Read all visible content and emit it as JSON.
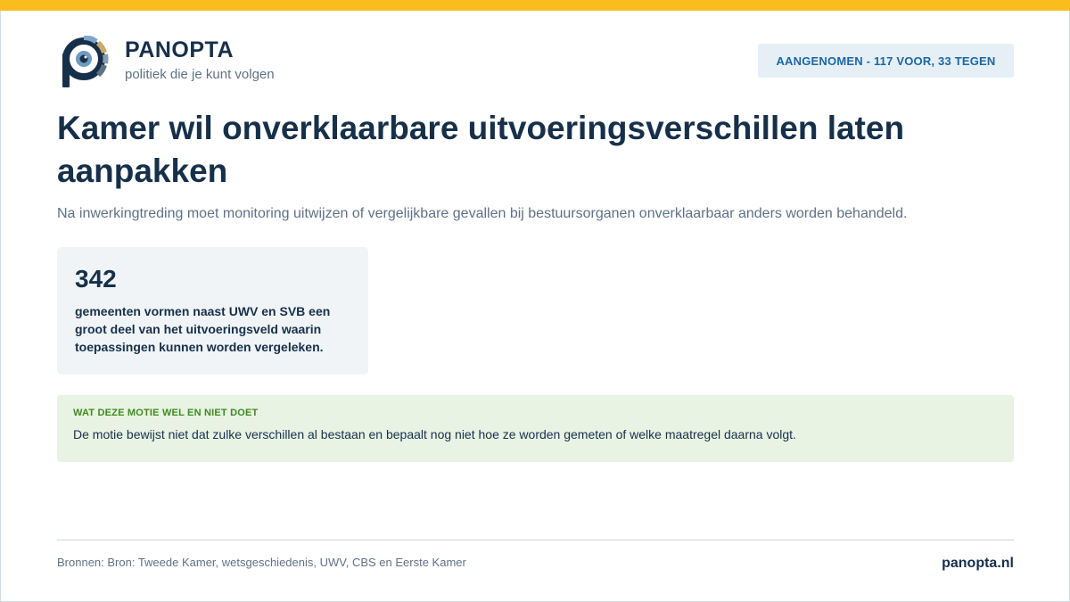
{
  "brand": {
    "name": "PANOPTA",
    "tagline": "politiek die je kunt volgen",
    "logo_icon": "eye-p-logo-icon"
  },
  "status": {
    "label": "AANGENOMEN - 117 VOOR, 33 TEGEN"
  },
  "article": {
    "title": "Kamer wil onverklaarbare uitvoeringsverschillen laten aanpakken",
    "subtitle": "Na inwerkingtreding moet monitoring uitwijzen of vergelijkbare gevallen bij bestuursorganen onverklaarbaar anders worden behandeld."
  },
  "stat": {
    "number": "342",
    "text": "gemeenten vormen naast UWV en SVB een groot deel van het uitvoeringsveld waarin toepassingen kunnen worden vergeleken."
  },
  "info": {
    "heading": "WAT DEZE MOTIE WEL EN NIET DOET",
    "text": "De motie bewijst niet dat zulke verschillen al bestaan en bepaalt nog niet hoe ze worden gemeten of welke maatregel daarna volgt."
  },
  "footer": {
    "sources": "Bronnen: Bron: Tweede Kamer, wetsgeschiedenis, UWV, CBS en Eerste Kamer",
    "site": "panopta.nl"
  },
  "colors": {
    "accent_bar": "#fbbd1e",
    "navy": "#17304a",
    "badge_bg": "#e6eff6",
    "badge_text": "#1a67a3",
    "info_bg": "#e8f3e4",
    "info_heading": "#3f8a1e"
  }
}
